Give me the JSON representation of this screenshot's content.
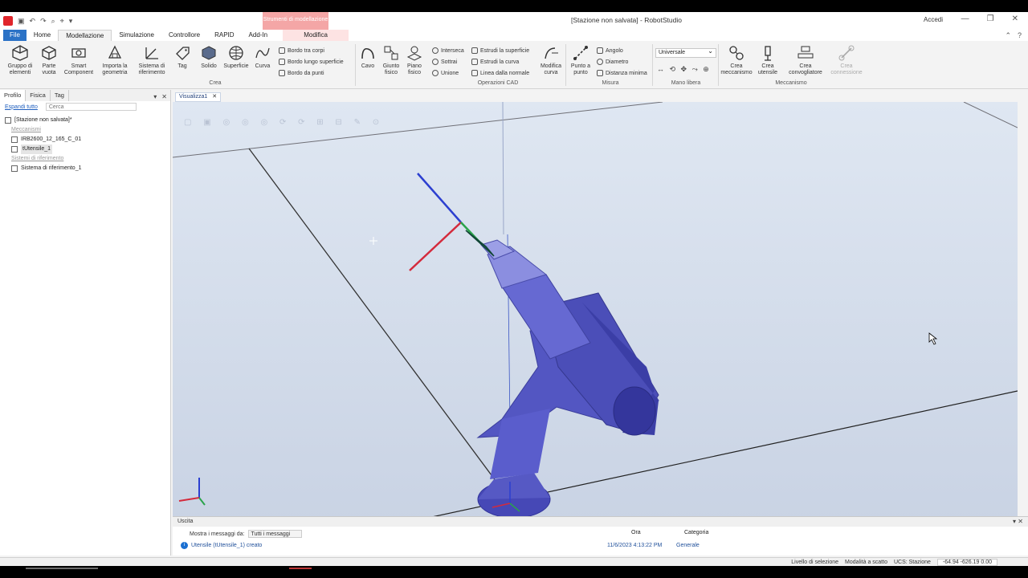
{
  "window": {
    "title": "[Stazione non salvata] - RobotStudio",
    "context_tab_header": "Strumenti di modellazione",
    "signin": "Accedi",
    "minimize": "—",
    "restore": "❐",
    "close": "✕"
  },
  "tabs": {
    "file": "File",
    "items": [
      "Home",
      "Modellazione",
      "Simulazione",
      "Controllore",
      "RAPID",
      "Add-In"
    ],
    "context": "Modifica"
  },
  "ribbon": {
    "crea": {
      "group_label": "Crea",
      "buttons": [
        "Gruppo di elementi",
        "Parte vuota",
        "Smart Component",
        "Importa la geometria",
        "Sistema di riferimento",
        "Tag",
        "Solido",
        "Superficie",
        "Curva"
      ],
      "small": [
        "Bordo tra corpi",
        "Bordo lungo superficie",
        "Bordo da punti"
      ]
    },
    "cad": {
      "group_label": "Operazioni CAD",
      "big": [
        "Cavo",
        "Giunto fisico",
        "Piano fisico"
      ],
      "small_col1": [
        "Interseca",
        "Sottrai",
        "Unione"
      ],
      "small_col2": [
        "Estrudi la superficie",
        "Estrudi la curva",
        "Linea dalla normale"
      ],
      "modify_curve": "Modifica curva"
    },
    "misura": {
      "group_label": "Misura",
      "point_to_point": "Punto a punto",
      "small": [
        "Angolo",
        "Diametro",
        "Distanza minima"
      ]
    },
    "mano": {
      "group_label": "Mano libera",
      "dropdown": "Universale"
    },
    "meccanismo": {
      "group_label": "Meccanismo",
      "buttons": [
        "Crea meccanismo",
        "Crea utensile",
        "Crea convogliatore",
        "Crea connessione"
      ]
    }
  },
  "left_panel": {
    "tabs": [
      "Profilo",
      "Fisica",
      "Tag"
    ],
    "expand_all": "Espandi tutto",
    "search_placeholder": "Cerca",
    "tree": {
      "root": "[Stazione non salvata]*",
      "mechanisms_header": "Meccanismi",
      "robot": "IRB2600_12_165_C_01",
      "tool": "tUtensile_1",
      "frames_header": "Sistemi di riferimento",
      "frame": "Sistema di riferimento_1"
    }
  },
  "viewport": {
    "tab_label": "Visualizza1"
  },
  "output": {
    "title": "Uscita",
    "filter_label": "Mostra i messaggi da:",
    "filter_value": "Tutti i messaggi",
    "col_time": "Ora",
    "col_category": "Categoria",
    "message": "Utensile (tUtensile_1) creato",
    "message_time": "11/6/2023 4:13:22 PM",
    "message_category": "Generale"
  },
  "statusbar": {
    "selection_level": "Livello di selezione",
    "snap_mode": "Modalità a scatto",
    "ucs": "UCS: Stazione",
    "coords": "-64.94 -626.19 0.00"
  },
  "colors": {
    "accent": "#2b72c6",
    "context_tab": "#f4a6a6",
    "tool_body": "#5a5fc9",
    "axis_x": "#d42a3c",
    "axis_y": "#2aa34a",
    "axis_z": "#2c3fd0"
  }
}
